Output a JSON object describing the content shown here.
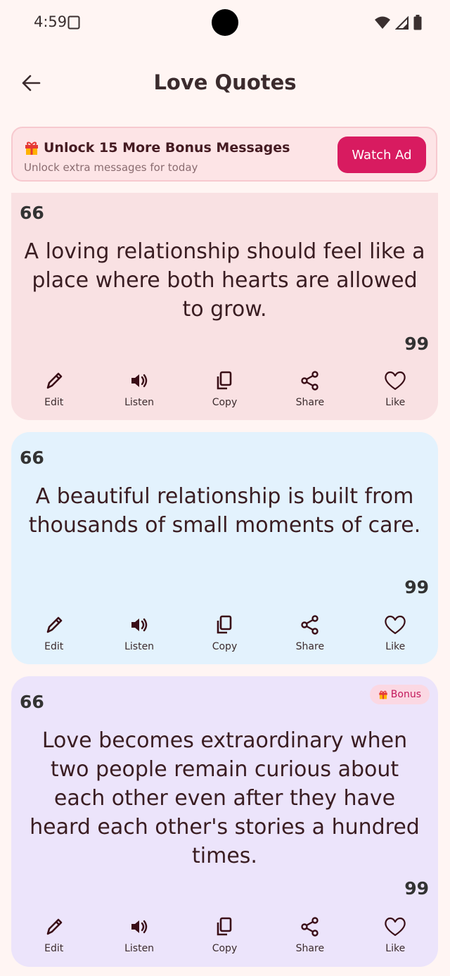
{
  "status_bar": {
    "time": "4:59"
  },
  "app_bar": {
    "title": "Love Quotes"
  },
  "banner": {
    "title": "Unlock 15 More Bonus Messages",
    "subtitle": "Unlock extra messages for today",
    "button_label": "Watch Ad"
  },
  "quote_marks": {
    "open": "66",
    "close": "99"
  },
  "actions": {
    "edit": "Edit",
    "listen": "Listen",
    "copy": "Copy",
    "share": "Share",
    "like": "Like"
  },
  "cards": [
    {
      "text": "A loving relationship should feel like a place where both hearts are allowed to grow.",
      "background": "#f9e1e3"
    },
    {
      "text": "A beautiful relationship is built from thousands of small moments of care.",
      "background": "#e3f2fd"
    },
    {
      "text": "Love becomes extraordinary when two people remain curious about each other even after they have heard each other's stories a hundred times.",
      "background": "#ece4fb",
      "badge": "Bonus"
    }
  ],
  "colors": {
    "accent": "#d81b60",
    "background": "#fff5f3"
  }
}
